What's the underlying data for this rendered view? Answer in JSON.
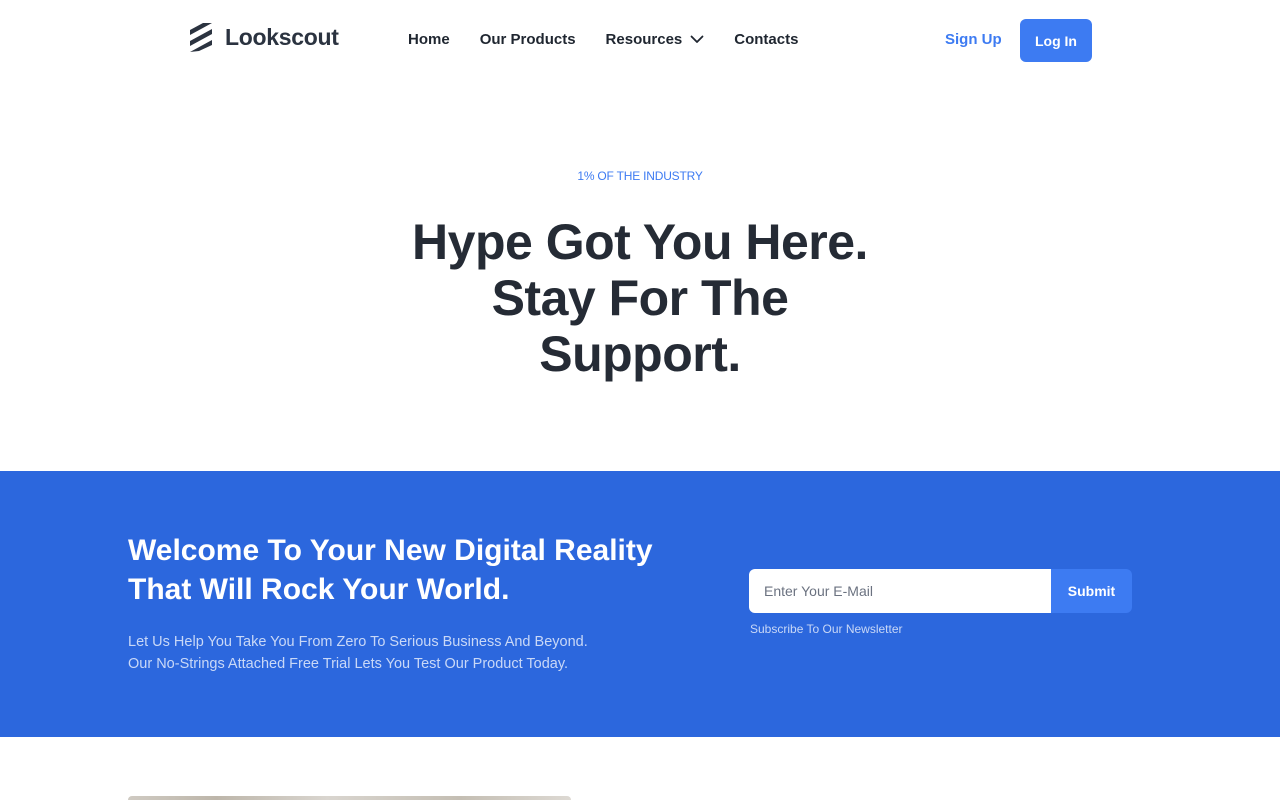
{
  "brand": {
    "name": "Lookscout",
    "logo_icon": "stacked-stripes-logo-icon"
  },
  "nav": {
    "items": [
      {
        "label": "Home"
      },
      {
        "label": "Our Products"
      },
      {
        "label": "Resources",
        "icon": "chevron-down-icon"
      },
      {
        "label": "Contacts"
      }
    ],
    "signup_label": "Sign Up",
    "login_label": "Log In"
  },
  "hero": {
    "eyebrow": "1% OF THE INDUSTRY",
    "title": "Hype Got You Here. Stay For The Support."
  },
  "band": {
    "title": "Welcome To Your New Digital Reality That Will Rock Your World.",
    "text_line1": "Let Us Help You Take You From Zero To Serious Business And Beyond.",
    "text_line2": "Our No-Strings Attached Free Trial Lets You Test Our Product Today.",
    "email_placeholder": "Enter Your E-Mail",
    "submit_label": "Submit",
    "newsletter_note": "Subscribe To Our Newsletter"
  },
  "colors": {
    "accent": "#3d7bf2",
    "band_background": "#2c67dd",
    "heading": "#252b35"
  }
}
